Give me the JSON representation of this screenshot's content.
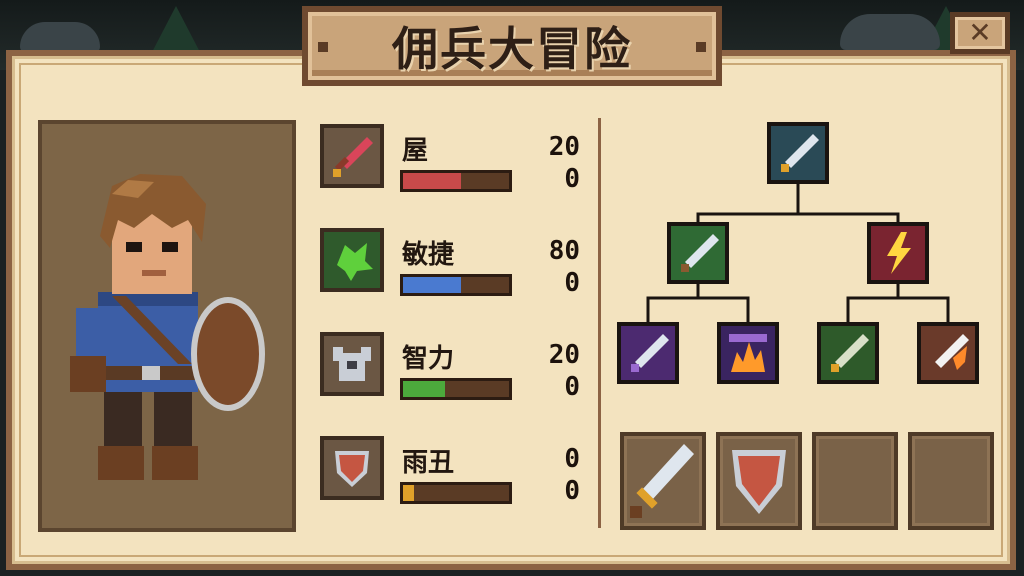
{
  "title": "佣兵大冒险",
  "close_label": "✕",
  "stats": [
    {
      "label": "屋",
      "value": "20",
      "value2": "0",
      "fill": 0.55,
      "color": "#c84a4a",
      "icon": "sword-icon"
    },
    {
      "label": "敏捷",
      "value": "80",
      "value2": "0",
      "fill": 0.55,
      "color": "#4a7ad0",
      "icon": "green-splash-icon"
    },
    {
      "label": "智力",
      "value": "20",
      "value2": "0",
      "fill": 0.4,
      "color": "#4caa3c",
      "icon": "silver-helmet-icon"
    },
    {
      "label": "雨丑",
      "value": "0",
      "value2": "0",
      "fill": 0.1,
      "color": "#e0a12a",
      "icon": "red-shield-icon"
    }
  ],
  "skill_tree": {
    "root": "sword-skill-icon",
    "tier2": [
      "green-sword-skill-icon",
      "lightning-skill-icon"
    ],
    "tier3": [
      "purple-sword-skill-icon",
      "purple-fire-skill-icon",
      "green-blade-skill-icon",
      "flame-sword-skill-icon"
    ]
  },
  "inventory": [
    "steel-sword-icon",
    "red-shield-icon",
    "empty-slot",
    "empty-slot"
  ],
  "colors": {
    "panel": "#f3e3bf",
    "frame": "#8c6344",
    "portrait_bg": "#7d6547"
  }
}
